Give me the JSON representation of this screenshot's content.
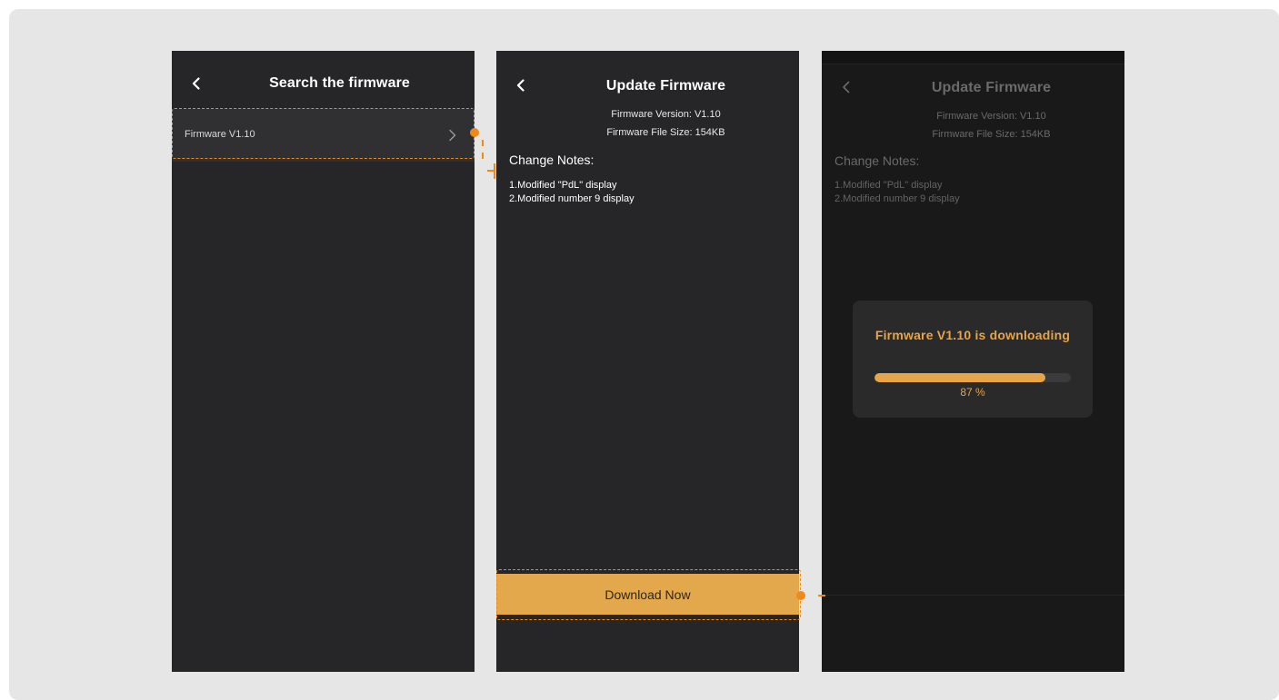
{
  "screen1": {
    "title": "Search the firmware",
    "firmware_item": "Firmware V1.10"
  },
  "screen2": {
    "title": "Update Firmware",
    "version_line": "Firmware Version: V1.10",
    "size_line": "Firmware File Size: 154KB",
    "notes_heading": "Change Notes:",
    "notes": [
      "1.Modified \"PdL\" display",
      "2.Modified number 9 display"
    ],
    "download_button": "Download Now"
  },
  "screen3": {
    "title": "Update Firmware",
    "version_line": "Firmware Version: V1.10",
    "size_line": "Firmware File Size: 154KB",
    "notes_heading": "Change Notes:",
    "notes": [
      "1.Modified \"PdL\" display",
      "2.Modified number 9 display"
    ],
    "dialog_title": "Firmware V1.10 is downloading",
    "progress_percent": 87,
    "progress_label": "87 %"
  },
  "colors": {
    "accent": "#e3a84b",
    "annotation": "#ee8a1c",
    "phone_bg": "#262628",
    "canvas_bg": "#e6e6e6"
  },
  "icons": [
    "back-chevron-icon",
    "chevron-right-icon"
  ]
}
